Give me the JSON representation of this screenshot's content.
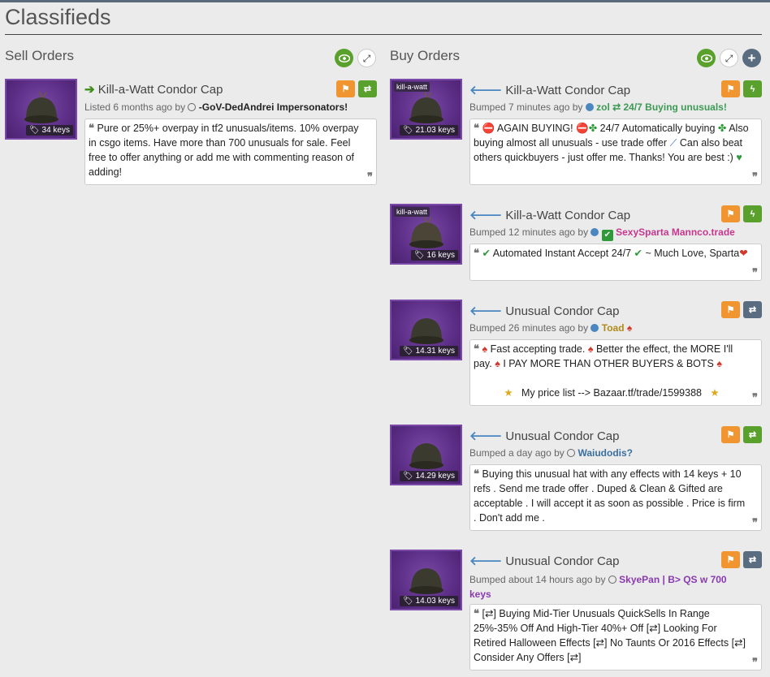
{
  "page": {
    "title": "Classifieds"
  },
  "sell": {
    "heading": "Sell Orders",
    "listings": [
      {
        "img_label": "",
        "price": "34 keys",
        "title": "Kill-a-Watt Condor Cap",
        "meta_prefix": "Listed 6 months ago by",
        "user": "-GoV-DedAndrei Impersonators!",
        "text": "Pure or 25%+ overpay in tf2 unusuals/items. 10% overpay in csgo items. Have more than 700 unusuals for sale. Feel free to offer anything or add me with commenting reason of adding!"
      }
    ]
  },
  "buy": {
    "heading": "Buy Orders",
    "listings": [
      {
        "img_label": "kill-a-watt",
        "price": "21.03 keys",
        "title": "Kill-a-Watt Condor Cap",
        "meta_prefix": "Bumped 7 minutes ago by",
        "user": "zol ⇄ 24/7 Buying unusuals!",
        "text_parts": [
          "AGAIN BUYING!",
          "24/7 Automatically buying",
          "Also buying almost all unusuals - use trade offer",
          "Can also beat others quickbuyers - just offer me. Thanks! You are best :)"
        ]
      },
      {
        "img_label": "kill-a-watt",
        "price": "16 keys",
        "title": "Kill-a-Watt Condor Cap",
        "meta_prefix": "Bumped 12 minutes ago by",
        "user": "SexySparta Mannco.trade",
        "text_parts": [
          "Automated Instant Accept 24/7",
          "~ Much Love, Sparta"
        ]
      },
      {
        "img_label": "",
        "price": "14.31 keys",
        "title": "Unusual Condor Cap",
        "meta_prefix": "Bumped 26 minutes ago by",
        "user": "Toad",
        "text_parts": [
          "Fast accepting trade.",
          "Better the effect, the MORE I'll pay.",
          "I PAY MORE THAN OTHER BUYERS & BOTS",
          "My price list --> Bazaar.tf/trade/1599388"
        ]
      },
      {
        "img_label": "",
        "price": "14.29 keys",
        "title": "Unusual Condor Cap",
        "meta_prefix": "Bumped a day ago by",
        "user": "Waiudodis?",
        "text": "Buying this unusual hat with any effects with 14 keys + 10 refs . Send me trade offer . Duped & Clean & Gifted are acceptable . I will accept it as soon as possible . Price is firm . Don't add me ."
      },
      {
        "img_label": "",
        "price": "14.03 keys",
        "title": "Unusual Condor Cap",
        "meta_prefix": "Bumped about 14 hours ago by",
        "user": "SkyePan | B> QS w 700 keys",
        "text": "[⇄] Buying Mid-Tier Unusuals QuickSells In Range 25%-35% Off And High-Tier 40%+ Off [⇄] Looking For Retired Halloween Effects [⇄] No Taunts Or 2016 Effects [⇄] Consider Any Offers [⇄]"
      }
    ]
  },
  "icons": {
    "eye": "eye-icon",
    "expand": "expand-icon",
    "plus": "plus-icon",
    "flag": "flag-icon",
    "swap": "swap-icon",
    "bolt": "bolt-icon",
    "tag": "tag-icon",
    "quote": "quote-icon"
  },
  "colors": {
    "orange": "#f0952f",
    "green": "#5aa02c",
    "slate": "#5a6c80",
    "purple": "#7b4aa8"
  }
}
